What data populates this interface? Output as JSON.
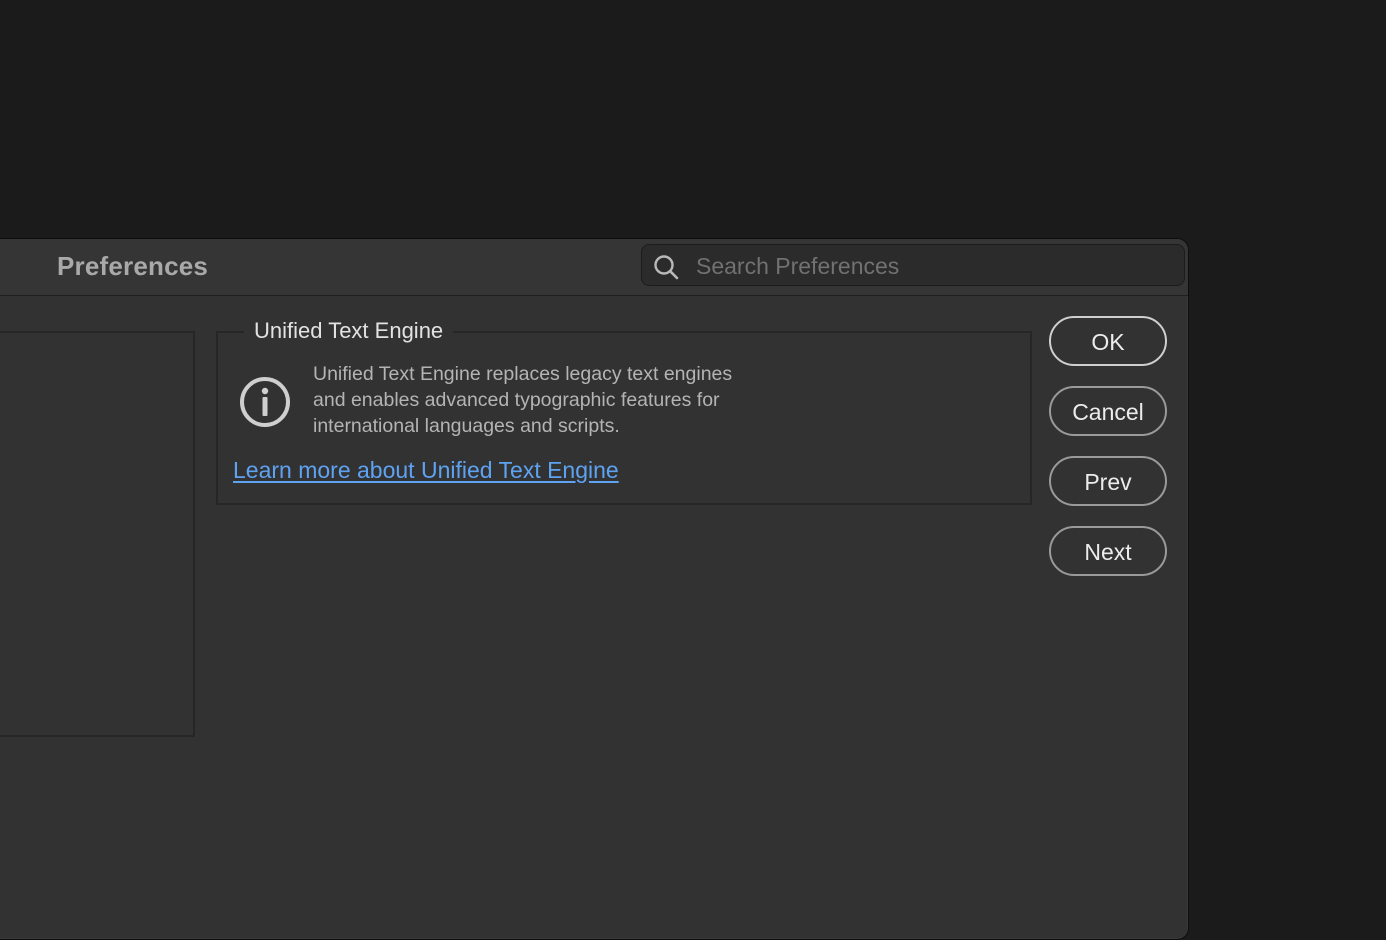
{
  "window": {
    "title": "Preferences"
  },
  "search": {
    "placeholder": "Search Preferences",
    "value": ""
  },
  "section": {
    "title": "Unified Text Engine",
    "description_lines": [
      "Unified Text Engine replaces legacy text engines",
      "and enables advanced typographic features for",
      "international languages and scripts."
    ],
    "link_text": "Learn more about Unified Text Engine",
    "info_icon": "info-icon"
  },
  "buttons": {
    "ok": "OK",
    "cancel": "Cancel",
    "prev": "Prev",
    "next": "Next"
  },
  "colors": {
    "link": "#5ea2f2",
    "window_bg": "#323232",
    "desktop_bg": "#1b1b1b"
  }
}
